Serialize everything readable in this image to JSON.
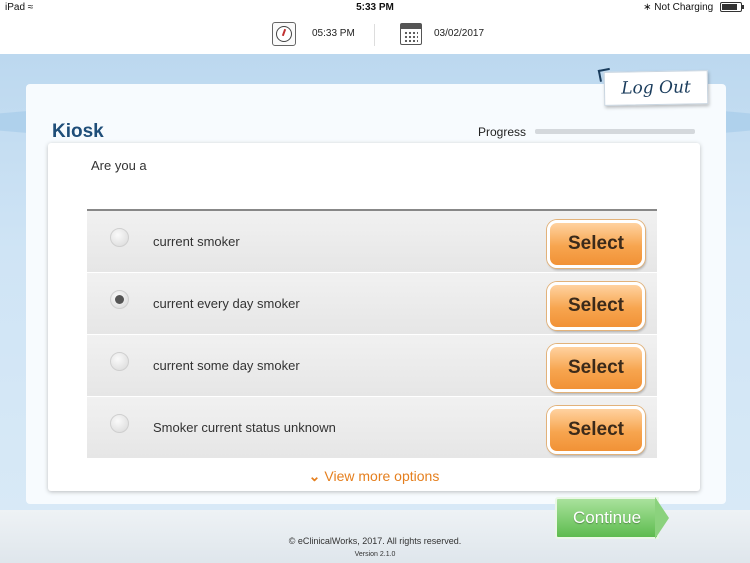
{
  "status_bar": {
    "device": "iPad",
    "time": "5:33 PM",
    "charging": "Not Charging"
  },
  "top_info": {
    "time": "05:33 PM",
    "date": "03/02/2017"
  },
  "header": {
    "title": "Kiosk",
    "logout_label": "Log Out",
    "progress_label": "Progress",
    "progress_fraction": 0.0
  },
  "question": {
    "prompt": "Are you a",
    "options": [
      {
        "label": "current smoker",
        "selected": false,
        "button": "Select"
      },
      {
        "label": "current every day smoker",
        "selected": true,
        "button": "Select"
      },
      {
        "label": "current some day smoker",
        "selected": false,
        "button": "Select"
      },
      {
        "label": "Smoker current status unknown",
        "selected": false,
        "button": "Select"
      }
    ],
    "more_label": "View more options"
  },
  "footer": {
    "continue_label": "Continue",
    "copyright": "© eClinicalWorks, 2017. All rights reserved.",
    "version": "Version 2.1.0"
  },
  "colors": {
    "brand_blue": "#1f4e79",
    "select_orange": "#f7a54f",
    "continue_green": "#5dbb4e",
    "link_orange": "#e57f1e"
  }
}
